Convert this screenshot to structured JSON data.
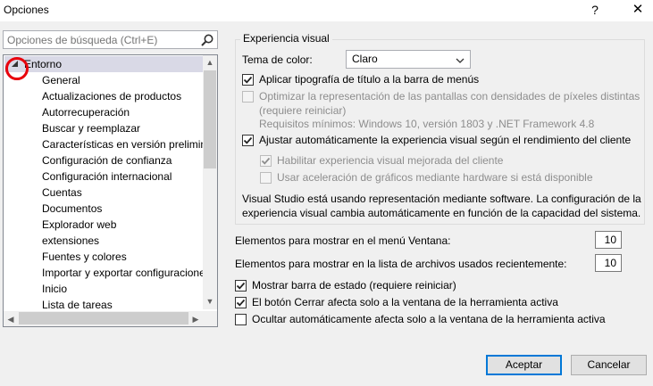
{
  "window": {
    "title": "Opciones",
    "help_glyph": "?",
    "close_glyph": "✕"
  },
  "search": {
    "placeholder": "Opciones de búsqueda (Ctrl+E)",
    "icon": "search-icon"
  },
  "tree": {
    "root_label": "Entorno",
    "children": [
      "General",
      "Actualizaciones de productos",
      "Autorrecuperación",
      "Buscar y reemplazar",
      "Características en versión preliminar",
      "Configuración de confianza",
      "Configuración internacional",
      "Cuentas",
      "Documentos",
      "Explorador web",
      "extensiones",
      "Fuentes y colores",
      "Importar y exportar configuraciones",
      "Inicio",
      "Lista de tareas"
    ]
  },
  "visual": {
    "group_label": "Experiencia visual",
    "theme_label": "Tema de color:",
    "theme_value": "Claro",
    "opt_title_typography": "Aplicar tipografía de título a la barra de menús",
    "opt_optimize_line1": "Optimizar la representación de las pantallas con densidades de píxeles distintas",
    "opt_optimize_line2": "(requiere reiniciar)",
    "requirements": "Requisitos mínimos: Windows 10, versión 1803 y .NET Framework 4.8",
    "opt_auto_adjust": "Ajustar automáticamente la experiencia visual según el rendimiento del cliente",
    "opt_enhanced": "Habilitar experiencia visual mejorada del cliente",
    "opt_hw_accel": "Usar aceleración de gráficos mediante hardware si está disponible",
    "info_line1": "Visual Studio está usando representación mediante software. La configuración de la",
    "info_line2": "experiencia visual cambia automáticamente en función de la capacidad del sistema."
  },
  "settings": {
    "window_menu_label": "Elementos para mostrar en el menú Ventana:",
    "window_menu_value": "10",
    "recent_files_label": "Elementos para mostrar en la lista de archivos usados recientemente:",
    "recent_files_value": "10",
    "opt_status_bar": "Mostrar barra de estado (requiere reiniciar)",
    "opt_close_button": "El botón Cerrar afecta solo a la ventana de la herramienta activa",
    "opt_autohide": "Ocultar automáticamente afecta solo a la ventana de la herramienta activa"
  },
  "checks": {
    "title_typography": true,
    "optimize": false,
    "auto_adjust": true,
    "enhanced": true,
    "hw_accel": false,
    "status_bar": true,
    "close_button": true,
    "autohide": false
  },
  "buttons": {
    "ok": "Aceptar",
    "cancel": "Cancelar"
  },
  "colors": {
    "accent": "#0078d7",
    "annotation": "#e8000b",
    "selection": "#d9d9e6"
  }
}
